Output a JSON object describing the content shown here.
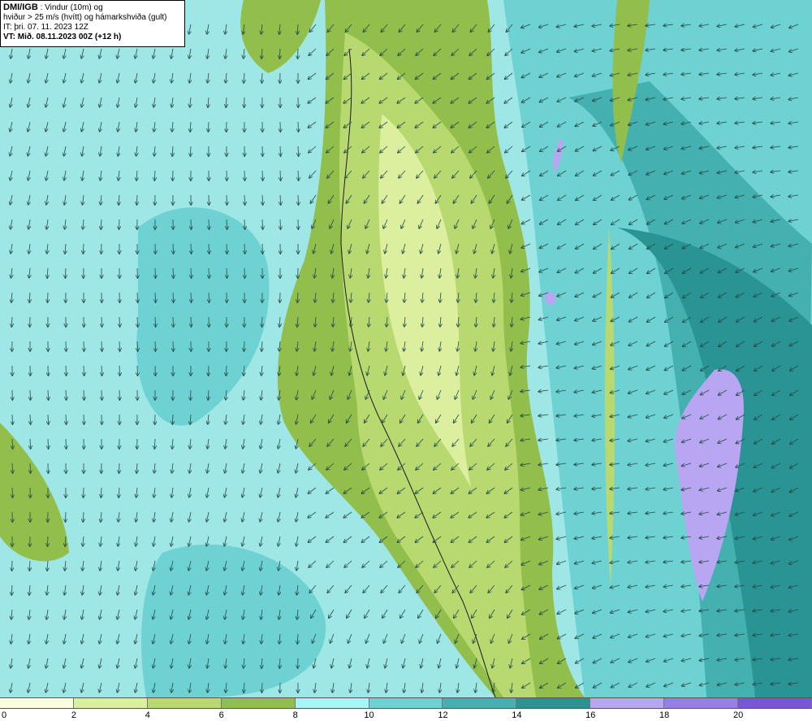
{
  "info": {
    "source": "DMI/IGB",
    "title_rest": ": Vindur (10m) og",
    "line2": "hviður > 25 m/s (hvítt) og hámarkshviða (gult)",
    "line3": "IT: þri. 07. 11. 2023 12Z",
    "line4": "VT: Mið. 08.11.2023 00Z (+12 h)"
  },
  "legend": {
    "colors": [
      "#fdfde0",
      "#dcef9f",
      "#b8d870",
      "#92be4c",
      "#a6f6f6",
      "#6fd2d2",
      "#45b0b0",
      "#2a9494",
      "#b9a6f2",
      "#9a7ee8",
      "#7a55d8"
    ],
    "labels": [
      "0",
      "2",
      "4",
      "6",
      "8",
      "10",
      "12",
      "14",
      "16",
      "18",
      "20"
    ]
  },
  "map": {
    "sea_color": "#9fe6e6",
    "mid_color": "#6fd2d2",
    "dark_color": "#45b0b0",
    "darker_color": "#2a9494",
    "land_color": "#b8d870",
    "land_light": "#dcef9f",
    "purple_color": "#b9a6f2",
    "arrow_color": "#234a4a"
  }
}
